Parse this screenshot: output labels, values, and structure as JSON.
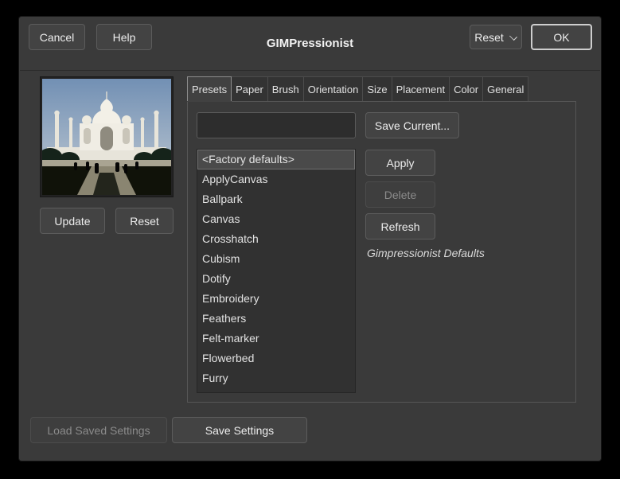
{
  "dialog": {
    "title": "GIMPressionist",
    "header": {
      "cancel_label": "Cancel",
      "help_label": "Help",
      "reset_label": "Reset",
      "ok_label": "OK"
    },
    "preview": {
      "image_alt": "taj-mahal-photo",
      "update_label": "Update",
      "reset_label": "Reset"
    },
    "tabs": [
      {
        "label": "Presets",
        "active": true
      },
      {
        "label": "Paper",
        "active": false
      },
      {
        "label": "Brush",
        "active": false
      },
      {
        "label": "Orientation",
        "active": false
      },
      {
        "label": "Size",
        "active": false
      },
      {
        "label": "Placement",
        "active": false
      },
      {
        "label": "Color",
        "active": false
      },
      {
        "label": "General",
        "active": false
      }
    ],
    "presets": {
      "entry_value": "",
      "save_current_label": "Save Current...",
      "apply_label": "Apply",
      "delete_label": "Delete",
      "refresh_label": "Refresh",
      "description": "Gimpressionist Defaults",
      "selected_index": 0,
      "list": [
        "<Factory defaults>",
        "ApplyCanvas",
        "Ballpark",
        "Canvas",
        "Crosshatch",
        "Cubism",
        "Dotify",
        "Embroidery",
        "Feathers",
        "Felt-marker",
        "Flowerbed",
        "Furry"
      ]
    },
    "footer": {
      "load_saved_label": "Load Saved Settings",
      "save_settings_label": "Save Settings"
    },
    "icons": {
      "reset_dropdown": "chevron-down"
    },
    "colors": {
      "dialog_bg": "#3a3a3a",
      "selection_bg": "#4a4a4a",
      "focus_border": "#cecece"
    },
    "states": {
      "delete_disabled": true,
      "load_saved_disabled": true
    }
  }
}
